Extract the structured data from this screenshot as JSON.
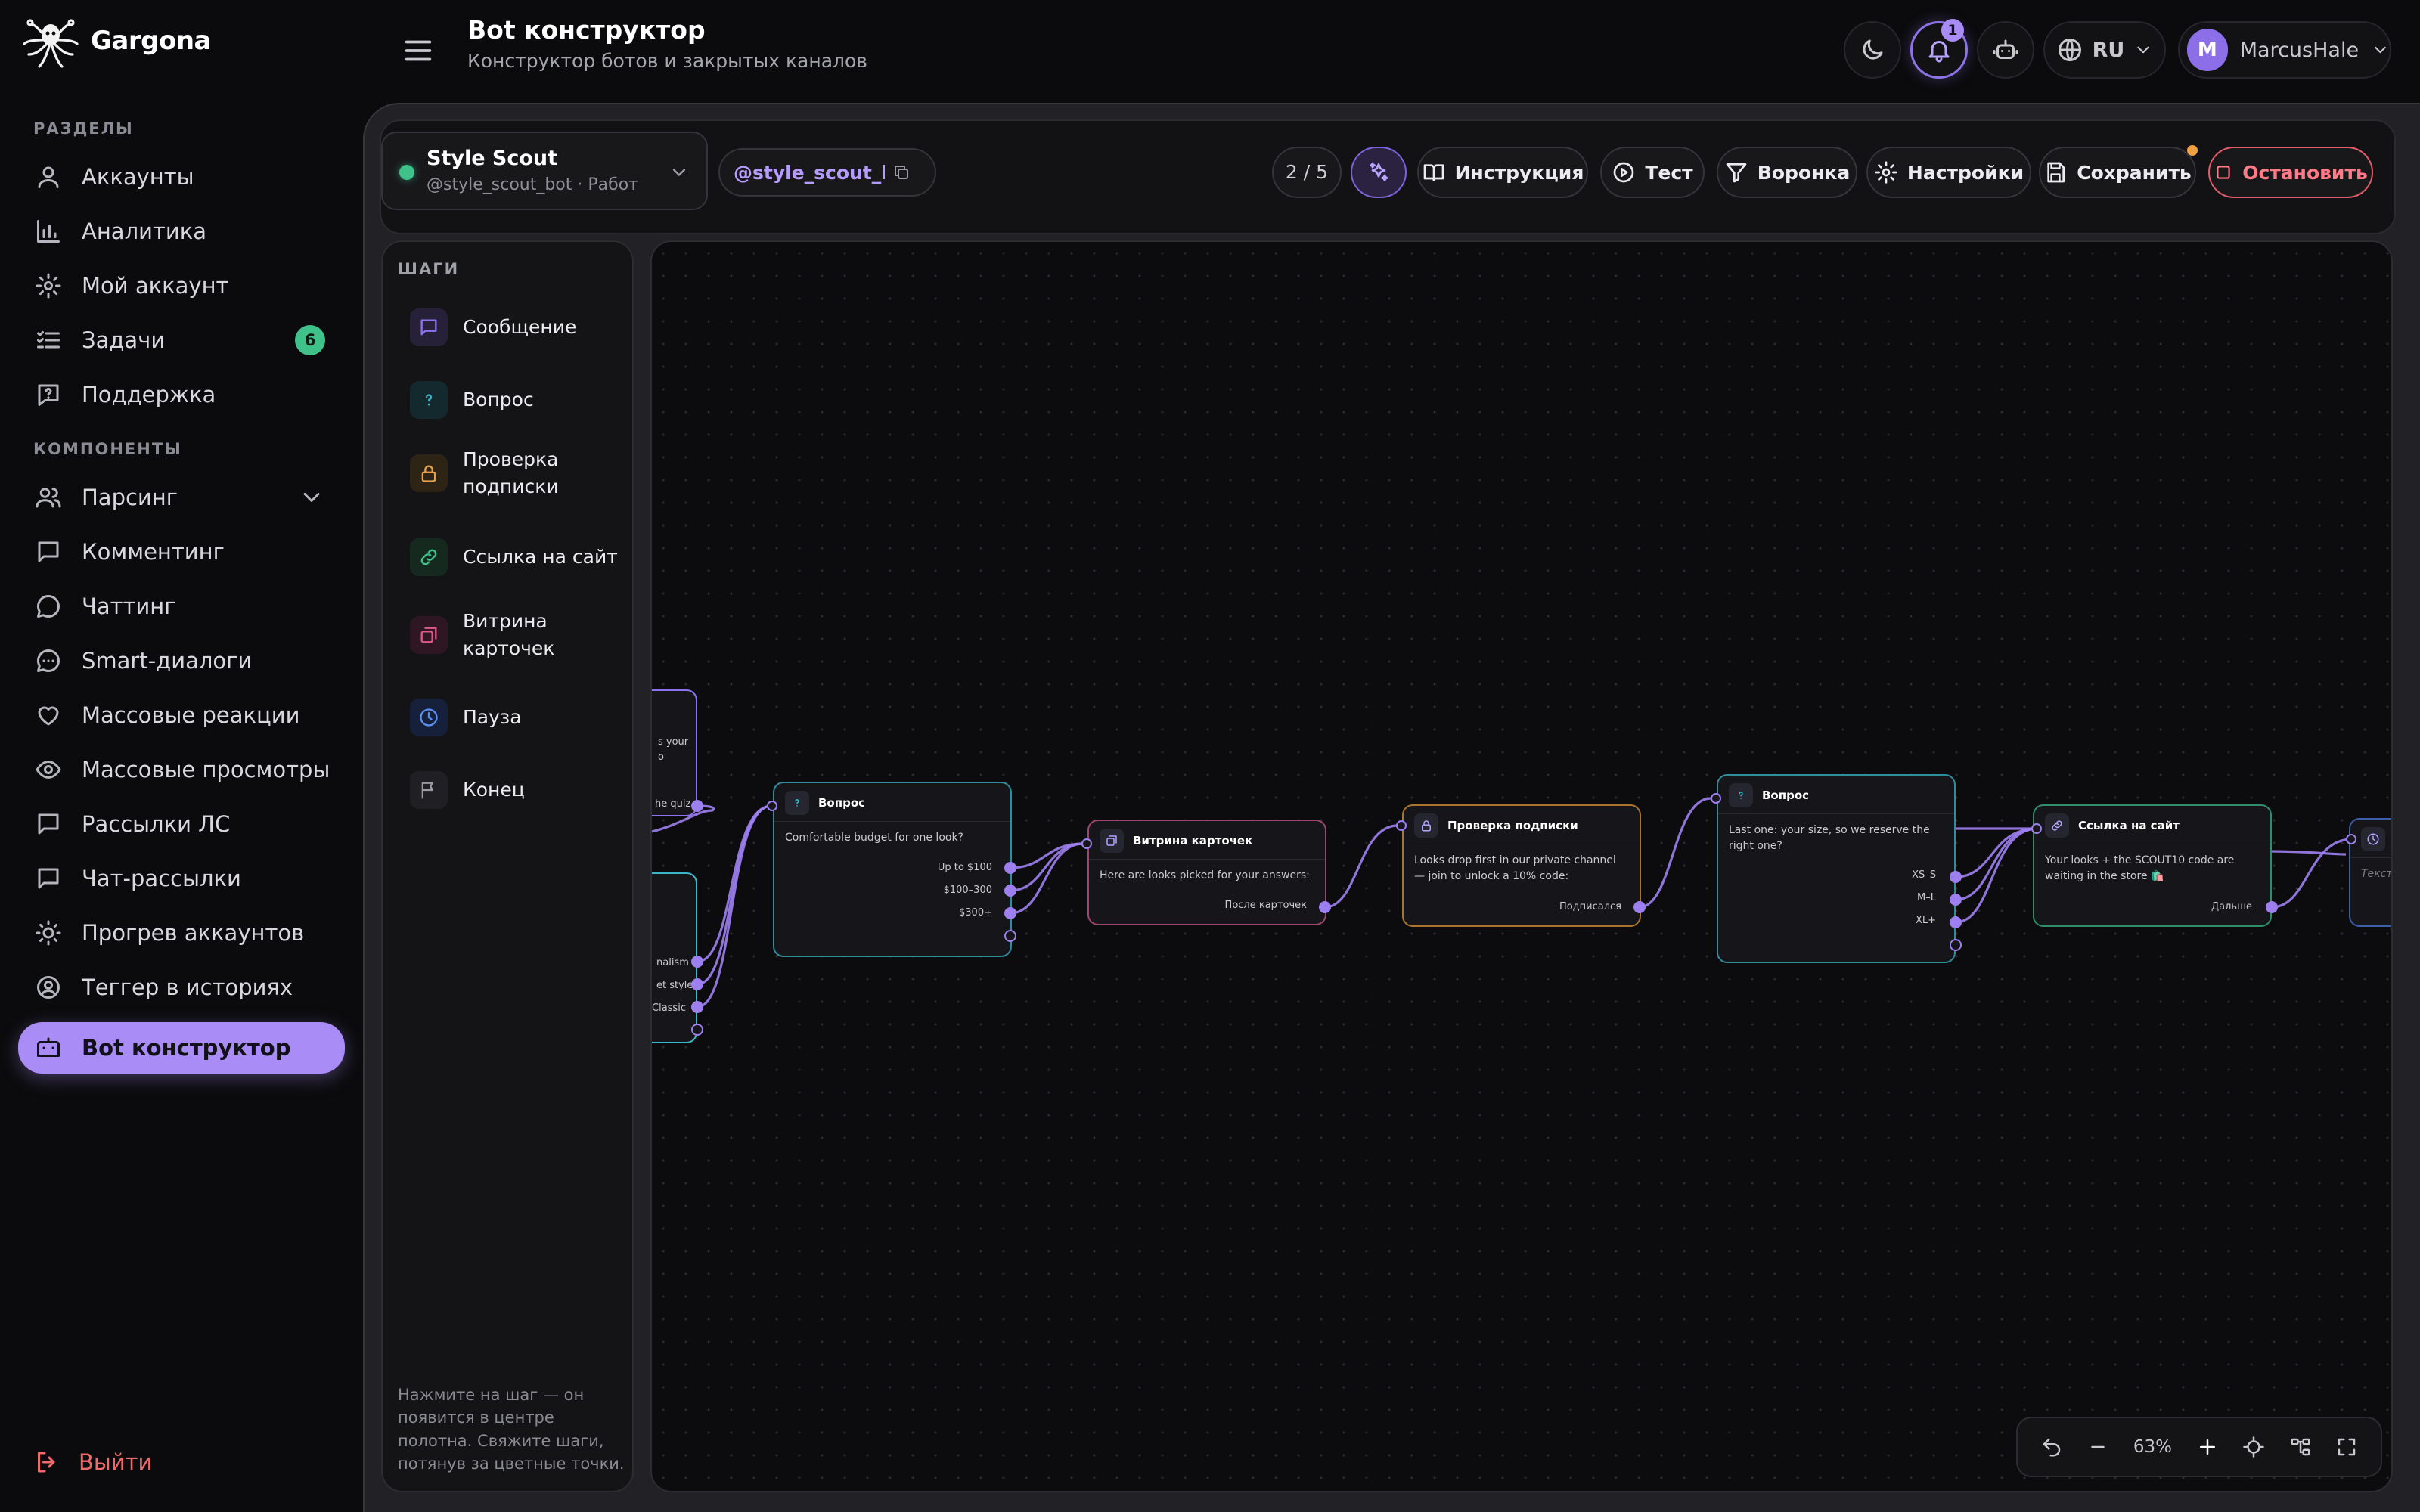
{
  "app": {
    "name": "Gargona"
  },
  "sidebar": {
    "section_main": "РАЗДЕЛЫ",
    "section_components": "КОМПОНЕНТЫ",
    "items": [
      {
        "label": "Аккаунты",
        "icon": "user-icon"
      },
      {
        "label": "Аналитика",
        "icon": "bar-chart-icon"
      },
      {
        "label": "Мой аккаунт",
        "icon": "gear-icon"
      },
      {
        "label": "Задачи",
        "icon": "list-check-icon",
        "badge": "6"
      },
      {
        "label": "Поддержка",
        "icon": "help-icon"
      },
      {
        "label": "Парсинг",
        "icon": "users-icon"
      },
      {
        "label": "Комментинг",
        "icon": "message-square-icon"
      },
      {
        "label": "Чаттинг",
        "icon": "message-circle-icon"
      },
      {
        "label": "Smart-диалоги",
        "icon": "chat-dots-icon"
      },
      {
        "label": "Массовые реакции",
        "icon": "heart-icon"
      },
      {
        "label": "Массовые просмотры",
        "icon": "eye-icon"
      },
      {
        "label": "Рассылки ЛС",
        "icon": "message-square-icon"
      },
      {
        "label": "Чат-рассылки",
        "icon": "message-square-icon"
      },
      {
        "label": "Прогрев аккаунтов",
        "icon": "sun-icon"
      },
      {
        "label": "Теггер в историях",
        "icon": "user-circle-icon"
      },
      {
        "label": "Bot конструктор",
        "icon": "bot-icon",
        "active": true
      }
    ],
    "logout": "Выйти"
  },
  "header": {
    "title": "Bot конструктор",
    "subtitle": "Конструктор ботов и закрытых каналов",
    "notifications": "1",
    "language": "RU",
    "user_initial": "M",
    "user_name": "MarcusHale"
  },
  "toolbar": {
    "bot_name": "Style Scout",
    "bot_sub": "@style_scout_bot · Работает",
    "handle": "@style_scout_bot",
    "step_counter": "2 / 5",
    "instruction": "Инструкция",
    "test": "Тест",
    "funnel": "Воронка",
    "settings": "Настройки",
    "save": "Сохранить",
    "stop": "Остановить"
  },
  "steps_panel": {
    "title": "ШАГИ",
    "items": [
      {
        "label": "Сообщение",
        "icon": "message-icon",
        "color": "#8b73f0"
      },
      {
        "label": "Вопрос",
        "icon": "question-icon",
        "color": "#3bb6c9"
      },
      {
        "label": "Проверка подписки",
        "icon": "lock-icon",
        "color": "#e6a04a"
      },
      {
        "label": "Ссылка на сайт",
        "icon": "link-icon",
        "color": "#3fc18a"
      },
      {
        "label": "Витрина карточек",
        "icon": "cards-icon",
        "color": "#e0588a"
      },
      {
        "label": "Пауза",
        "icon": "clock-icon",
        "color": "#5b8ff0"
      },
      {
        "label": "Конец",
        "icon": "flag-icon",
        "color": "#9a9aa2"
      }
    ],
    "hint": "Нажмите на шаг — он появится в центре полотна. Свяжите шаги, потянув за цветные точки."
  },
  "canvas": {
    "left_fragments": {
      "top_text": "s your\no",
      "top_option": "he quiz",
      "bottom_options": [
        "nalism",
        "et style",
        "Classic"
      ]
    },
    "nodes": [
      {
        "id": "q1",
        "title": "Вопрос",
        "body": "Comfortable budget for one look?",
        "options": [
          "Up to $100",
          "$100–300",
          "$300+"
        ],
        "accent": "#3bb6c9"
      },
      {
        "id": "cards",
        "title": "Витрина карточек",
        "body": "Here are looks picked for your answers:",
        "options": [
          "После карточек"
        ],
        "accent": "#e0588a"
      },
      {
        "id": "sub",
        "title": "Проверка подписки",
        "body": "Looks drop first in our private channel — join to unlock a 10% code:",
        "options": [
          "Подписался"
        ],
        "accent": "#e6a04a"
      },
      {
        "id": "q2",
        "title": "Вопрос",
        "body": "Last one: your size, so we reserve the right one?",
        "options": [
          "XS–S",
          "M–L",
          "XL+"
        ],
        "accent": "#3bb6c9"
      },
      {
        "id": "link",
        "title": "Ссылка на сайт",
        "body": "Your looks + the SCOUT10 code are waiting in the store 🛍️",
        "options": [
          "Дальше"
        ],
        "accent": "#3fc18a"
      },
      {
        "id": "pause",
        "title": "",
        "body": "Текст",
        "options": [],
        "accent": "#5b8ff0"
      }
    ]
  },
  "zoom": {
    "level": "63%"
  }
}
